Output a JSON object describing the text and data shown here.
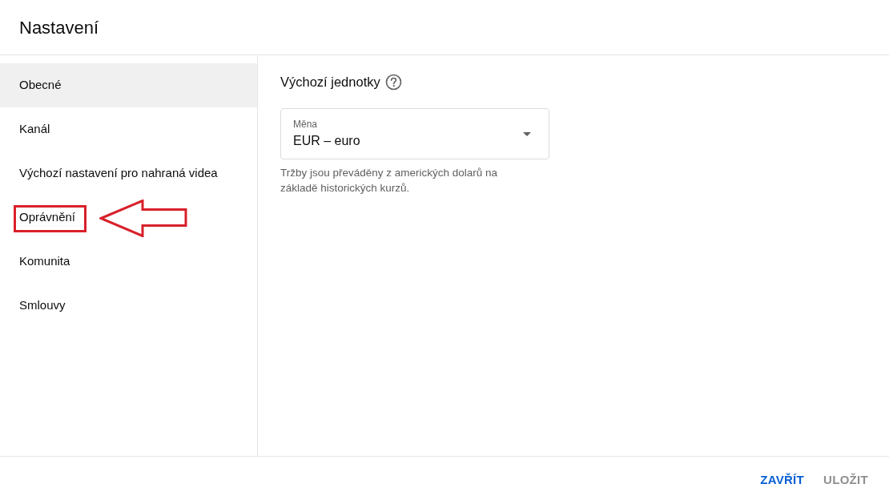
{
  "window": {
    "title": "Nastavení"
  },
  "sidebar": {
    "items": [
      {
        "label": "Obecné",
        "selected": true,
        "highlighted": false
      },
      {
        "label": "Kanál",
        "selected": false,
        "highlighted": false
      },
      {
        "label": "Výchozí nastavení pro nahraná videa",
        "selected": false,
        "highlighted": false
      },
      {
        "label": "Oprávnění",
        "selected": false,
        "highlighted": true
      },
      {
        "label": "Komunita",
        "selected": false,
        "highlighted": false
      },
      {
        "label": "Smlouvy",
        "selected": false,
        "highlighted": false
      }
    ]
  },
  "content": {
    "section_title": "Výchozí jednotky",
    "currency_select": {
      "label": "Měna",
      "value": "EUR – euro"
    },
    "helper_text": "Tržby jsou převáděny z amerických dolarů na základě historických kurzů."
  },
  "buttons": [
    {
      "label": "ZAVŘÍT",
      "disabled": false
    },
    {
      "label": "ULOŽIT",
      "disabled": true
    }
  ]
}
